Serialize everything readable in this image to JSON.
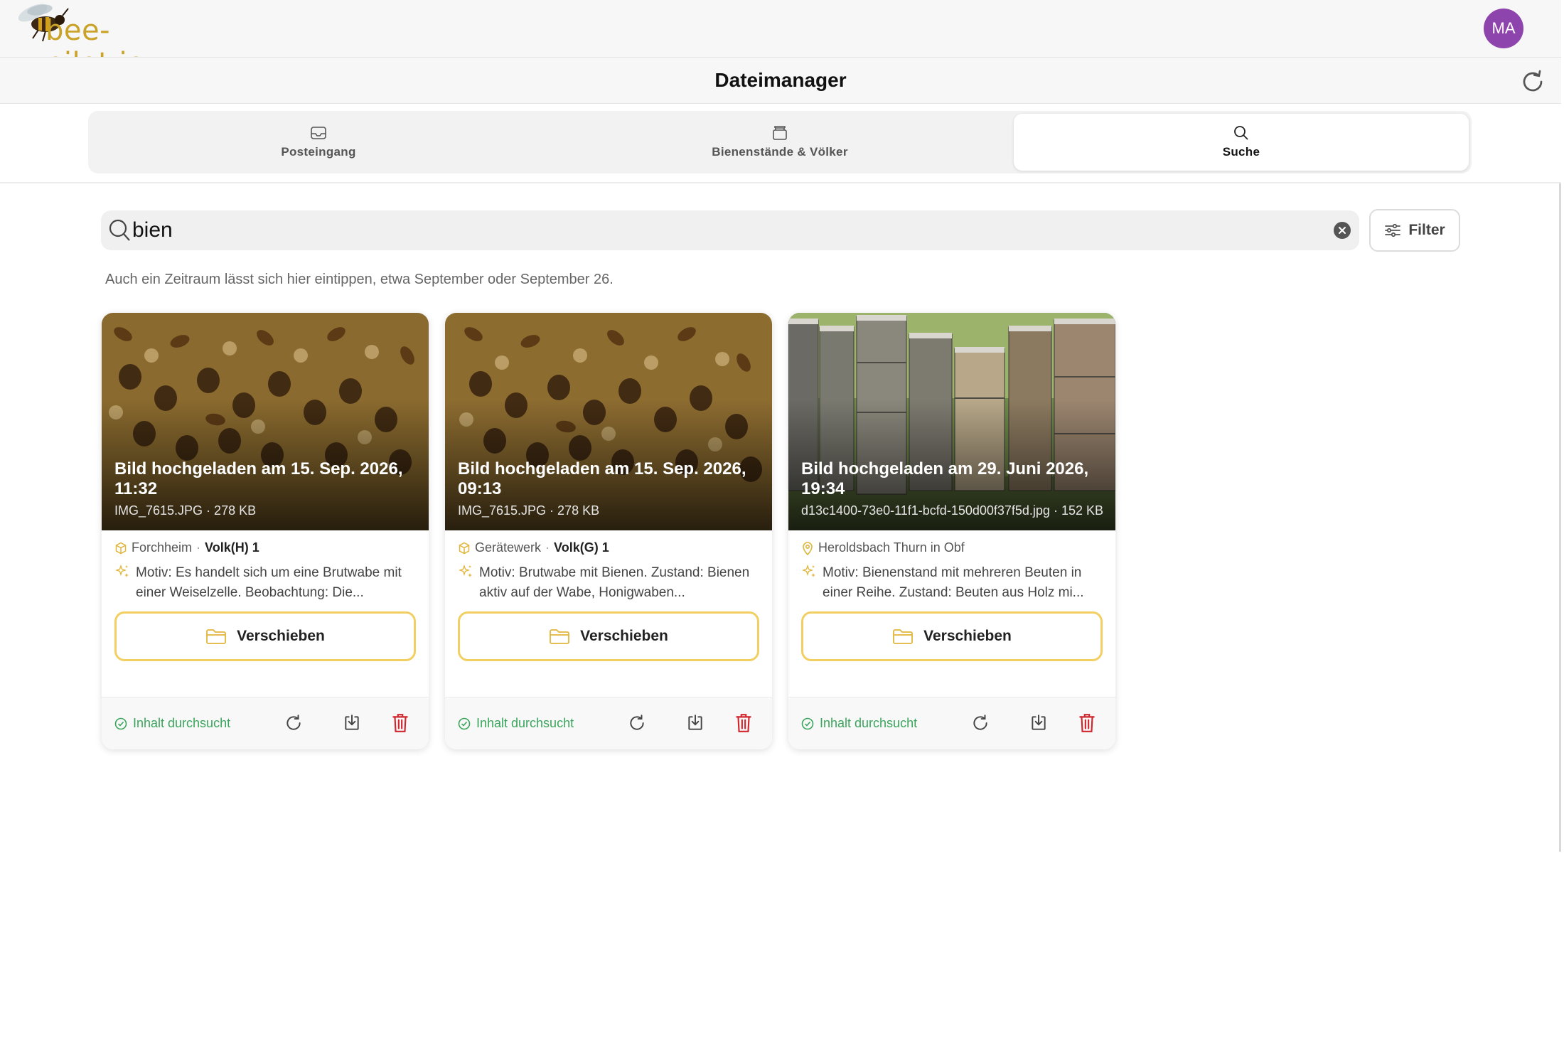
{
  "header": {
    "logo_text": "bee-pilot.io",
    "avatar_initials": "MA"
  },
  "page": {
    "title": "Dateimanager"
  },
  "tabs": [
    {
      "label": "Posteingang",
      "icon": "inbox-icon"
    },
    {
      "label": "Bienenstände & Völker",
      "icon": "archive-icon"
    },
    {
      "label": "Suche",
      "icon": "search-icon",
      "active": true
    }
  ],
  "search": {
    "value": "bien",
    "filter_label": "Filter"
  },
  "hint": "Auch ein Zeitraum lässt sich hier eintippen, etwa September oder September 26.",
  "cards": [
    {
      "title": "Bild hochgeladen am 15. Sep. 2026, 11:32",
      "file": "IMG_7615.JPG · 278 KB",
      "location": "Forchheim",
      "separator": "·",
      "colony": "Volk(H) 1",
      "location_icon": "cube-icon",
      "motiv": "Motiv: Es handelt sich um eine Brutwabe mit einer Weiselzelle. Beobachtung: Die...",
      "move_label": "Verschieben",
      "status": "Inhalt durchsucht",
      "image": "honeycomb"
    },
    {
      "title": "Bild hochgeladen am 15. Sep. 2026, 09:13",
      "file": "IMG_7615.JPG · 278 KB",
      "location": "Gerätewerk",
      "separator": "·",
      "colony": "Volk(G) 1",
      "location_icon": "cube-icon",
      "motiv": "Motiv: Brutwabe mit Bienen. Zustand: Bienen aktiv auf der Wabe, Honigwaben...",
      "move_label": "Verschieben",
      "status": "Inhalt durchsucht",
      "image": "honeycomb"
    },
    {
      "title": "Bild hochgeladen am 29. Juni 2026, 19:34",
      "file": "d13c1400-73e0-11f1-bcfd-150d00f37f5d.jpg · 152 KB",
      "location": "Heroldsbach Thurn in Obf",
      "separator": "",
      "colony": "",
      "location_icon": "map-pin-icon",
      "motiv": "Motiv: Bienenstand mit mehreren Beuten in einer Reihe. Zustand: Beuten aus Holz mi...",
      "move_label": "Verschieben",
      "status": "Inhalt durchsucht",
      "image": "hives"
    }
  ],
  "colors": {
    "accent": "#f2cf63",
    "status_green": "#3aa55a",
    "delete_red": "#d0262d",
    "avatar": "#8e44ad",
    "logo": "#c9a227"
  }
}
